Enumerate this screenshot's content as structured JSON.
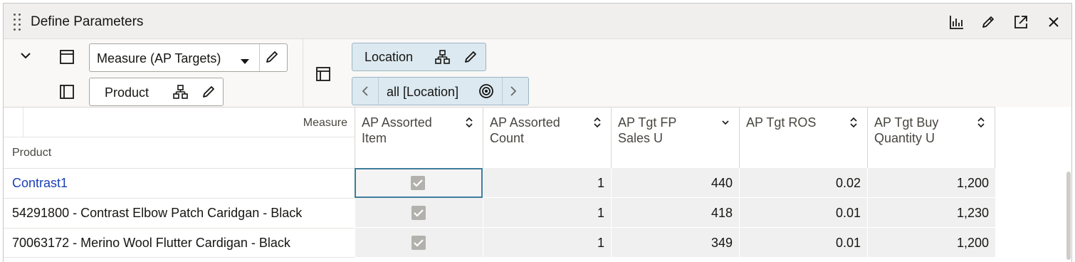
{
  "window": {
    "title": "Define Parameters",
    "icons": [
      "chart-icon",
      "edit-icon",
      "expand-icon",
      "close-icon"
    ]
  },
  "toolbar": {
    "row_edge": {
      "label": "Measure (AP Targets)"
    },
    "column_edge": {
      "label": "Product"
    },
    "page_edge": {
      "label": "Location"
    },
    "page_selector": {
      "value": "all [Location]"
    }
  },
  "grid": {
    "header_measure": "Measure",
    "header_product": "Product",
    "columns": [
      {
        "label": "AP Assorted Item",
        "sort": "both"
      },
      {
        "label": "AP Assorted Count",
        "sort": "both"
      },
      {
        "label": "AP Tgt FP Sales U",
        "sort": "descending"
      },
      {
        "label": "AP Tgt ROS",
        "sort": "both"
      },
      {
        "label": "AP Tgt Buy Quantity U",
        "sort": "both"
      }
    ],
    "rows": [
      {
        "label": "Contrast1",
        "is_link": true,
        "assorted": true,
        "count": "1",
        "fp_sales": "440",
        "ros": "0.02",
        "buy_qty": "1,200"
      },
      {
        "label": "54291800 - Contrast Elbow Patch Caridgan - Black",
        "is_link": false,
        "assorted": true,
        "count": "1",
        "fp_sales": "418",
        "ros": "0.01",
        "buy_qty": "1,230"
      },
      {
        "label": "70063172 - Merino Wool Flutter Cardigan - Black",
        "is_link": false,
        "assorted": true,
        "count": "1",
        "fp_sales": "349",
        "ros": "0.01",
        "buy_qty": "1,200"
      }
    ]
  },
  "colors": {
    "link": "#1a3fb4",
    "chip_bg": "#dce9f0",
    "header_bg": "#f1efed",
    "cell_bg": "#f0f0f0"
  }
}
